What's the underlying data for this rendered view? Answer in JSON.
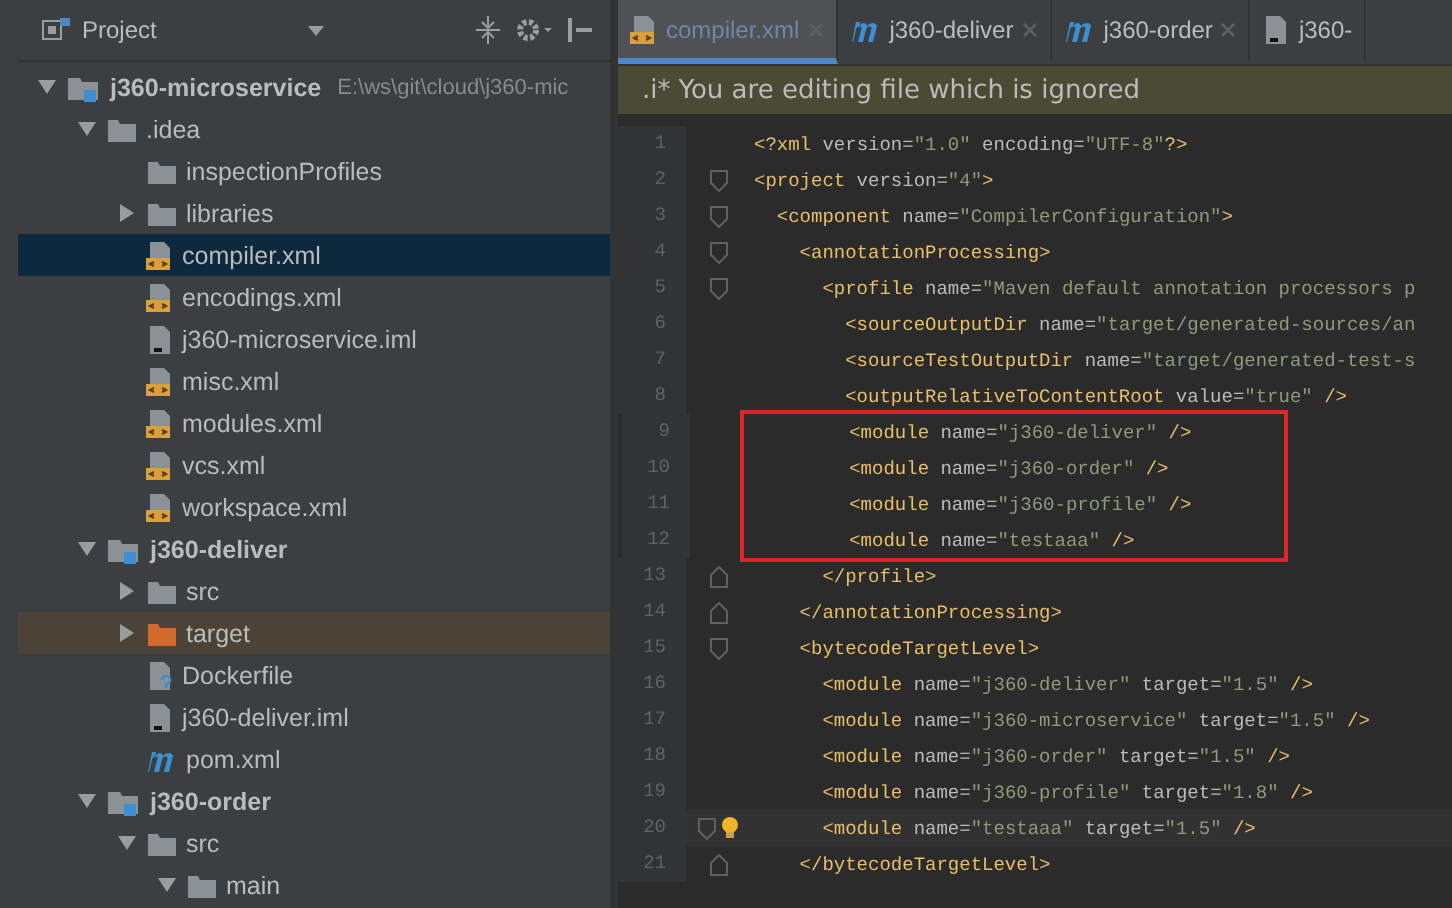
{
  "project_panel": {
    "title": "Project",
    "tree": [
      {
        "label": "j360-microservice",
        "path": "E:\\ws\\git\\cloud\\j360-mic",
        "kind": "module",
        "expanded": true,
        "selected": false,
        "children": [
          {
            "label": ".idea",
            "kind": "folder",
            "expanded": true,
            "selected": false,
            "children": [
              {
                "label": "inspectionProfiles",
                "kind": "folder",
                "selected": false
              },
              {
                "label": "libraries",
                "kind": "folder",
                "expanded": false,
                "selected": false
              },
              {
                "label": "compiler.xml",
                "kind": "xml",
                "selected": true
              },
              {
                "label": "encodings.xml",
                "kind": "xml",
                "selected": false
              },
              {
                "label": "j360-microservice.iml",
                "kind": "iml",
                "selected": false
              },
              {
                "label": "misc.xml",
                "kind": "xml",
                "selected": false
              },
              {
                "label": "modules.xml",
                "kind": "xml",
                "selected": false
              },
              {
                "label": "vcs.xml",
                "kind": "xml",
                "selected": false
              },
              {
                "label": "workspace.xml",
                "kind": "xml",
                "selected": false
              }
            ]
          },
          {
            "label": "j360-deliver",
            "kind": "module",
            "expanded": true,
            "selected": false,
            "children": [
              {
                "label": "src",
                "kind": "folder",
                "expanded": false,
                "selected": false
              },
              {
                "label": "target",
                "kind": "excluded",
                "expanded": false,
                "selected": false,
                "hovered": true
              },
              {
                "label": "Dockerfile",
                "kind": "dockerfile",
                "selected": false
              },
              {
                "label": "j360-deliver.iml",
                "kind": "iml",
                "selected": false
              },
              {
                "label": "pom.xml",
                "kind": "maven",
                "selected": false
              }
            ]
          },
          {
            "label": "j360-order",
            "kind": "module",
            "expanded": true,
            "selected": false,
            "children": [
              {
                "label": "src",
                "kind": "folder",
                "expanded": true,
                "selected": false,
                "children": [
                  {
                    "label": "main",
                    "kind": "folder",
                    "expanded": true,
                    "selected": false
                  }
                ]
              }
            ]
          }
        ]
      }
    ]
  },
  "editor": {
    "tabs": [
      {
        "label": "compiler.xml",
        "kind": "xml",
        "selected": true,
        "closable": true
      },
      {
        "label": "j360-deliver",
        "kind": "maven",
        "selected": false,
        "closable": true
      },
      {
        "label": "j360-order",
        "kind": "maven",
        "selected": false,
        "closable": true
      },
      {
        "label": "j360-",
        "kind": "iml",
        "selected": false,
        "closable": false
      }
    ],
    "banner": {
      "badge": ".i*",
      "message": "You are editing file which is ignored"
    },
    "lines": [
      {
        "number": "1",
        "segments": [
          {
            "kind": "tag",
            "text": "<?xml"
          },
          {
            "kind": "attr",
            "text": " version="
          },
          {
            "kind": "value",
            "text": "\"1.0\""
          },
          {
            "kind": "attr",
            "text": " encoding="
          },
          {
            "kind": "value",
            "text": "\"UTF-8\""
          },
          {
            "kind": "tag",
            "text": "?>"
          }
        ],
        "boxed": false,
        "current": false
      },
      {
        "number": "2",
        "segments": [
          {
            "kind": "tag",
            "text": "<project"
          },
          {
            "kind": "attr",
            "text": " version="
          },
          {
            "kind": "value",
            "text": "\"4\""
          },
          {
            "kind": "tag",
            "text": ">"
          }
        ],
        "boxed": false,
        "current": false,
        "fold_open": true
      },
      {
        "number": "3",
        "segments": [
          {
            "kind": "tag",
            "text": "  <component"
          },
          {
            "kind": "attr",
            "text": " name="
          },
          {
            "kind": "value",
            "text": "\"CompilerConfiguration\""
          },
          {
            "kind": "tag",
            "text": ">"
          }
        ],
        "boxed": false,
        "current": false,
        "fold_open": true
      },
      {
        "number": "4",
        "segments": [
          {
            "kind": "tag",
            "text": "    <annotationProcessing>"
          }
        ],
        "boxed": false,
        "current": false,
        "fold_open": true
      },
      {
        "number": "5",
        "segments": [
          {
            "kind": "tag",
            "text": "      <profile"
          },
          {
            "kind": "attr",
            "text": " name="
          },
          {
            "kind": "value",
            "text": "\"Maven default annotation processors p"
          }
        ],
        "boxed": false,
        "current": false,
        "fold_open": true
      },
      {
        "number": "6",
        "segments": [
          {
            "kind": "tag",
            "text": "        <sourceOutputDir"
          },
          {
            "kind": "attr",
            "text": " name="
          },
          {
            "kind": "value",
            "text": "\"target/generated-sources/an"
          }
        ],
        "boxed": false,
        "current": false
      },
      {
        "number": "7",
        "segments": [
          {
            "kind": "tag",
            "text": "        <sourceTestOutputDir"
          },
          {
            "kind": "attr",
            "text": " name="
          },
          {
            "kind": "value",
            "text": "\"target/generated-test-s"
          }
        ],
        "boxed": false,
        "current": false
      },
      {
        "number": "8",
        "segments": [
          {
            "kind": "tag",
            "text": "        <outputRelativeToContentRoot"
          },
          {
            "kind": "attr",
            "text": " value="
          },
          {
            "kind": "value",
            "text": "\"true\""
          },
          {
            "kind": "tag",
            "text": " />"
          }
        ],
        "boxed": false,
        "current": false
      },
      {
        "number": "9",
        "segments": [
          {
            "kind": "tag",
            "text": "        <module"
          },
          {
            "kind": "attr",
            "text": " name="
          },
          {
            "kind": "value",
            "text": "\"j360-deliver\""
          },
          {
            "kind": "tag",
            "text": " />"
          }
        ],
        "boxed": true,
        "current": false
      },
      {
        "number": "10",
        "segments": [
          {
            "kind": "tag",
            "text": "        <module"
          },
          {
            "kind": "attr",
            "text": " name="
          },
          {
            "kind": "value",
            "text": "\"j360-order\""
          },
          {
            "kind": "tag",
            "text": " />"
          }
        ],
        "boxed": true,
        "current": false
      },
      {
        "number": "11",
        "segments": [
          {
            "kind": "tag",
            "text": "        <module"
          },
          {
            "kind": "attr",
            "text": " name="
          },
          {
            "kind": "value",
            "text": "\"j360-profile\""
          },
          {
            "kind": "tag",
            "text": " />"
          }
        ],
        "boxed": true,
        "current": false
      },
      {
        "number": "12",
        "segments": [
          {
            "kind": "tag",
            "text": "        <module"
          },
          {
            "kind": "attr",
            "text": " name="
          },
          {
            "kind": "value",
            "text": "\"testaaa\""
          },
          {
            "kind": "tag",
            "text": " />"
          }
        ],
        "boxed": true,
        "current": false
      },
      {
        "number": "13",
        "segments": [
          {
            "kind": "tag",
            "text": "      </profile>"
          }
        ],
        "boxed": false,
        "current": false,
        "fold_close": true
      },
      {
        "number": "14",
        "segments": [
          {
            "kind": "tag",
            "text": "    </annotationProcessing>"
          }
        ],
        "boxed": false,
        "current": false,
        "fold_close": true
      },
      {
        "number": "15",
        "segments": [
          {
            "kind": "tag",
            "text": "    <bytecodeTargetLevel>"
          }
        ],
        "boxed": false,
        "current": false,
        "fold_open": true
      },
      {
        "number": "16",
        "segments": [
          {
            "kind": "tag",
            "text": "      <module"
          },
          {
            "kind": "attr",
            "text": " name="
          },
          {
            "kind": "value",
            "text": "\"j360-deliver\""
          },
          {
            "kind": "attr",
            "text": " target="
          },
          {
            "kind": "value",
            "text": "\"1.5\""
          },
          {
            "kind": "tag",
            "text": " />"
          }
        ],
        "boxed": false,
        "current": false
      },
      {
        "number": "17",
        "segments": [
          {
            "kind": "tag",
            "text": "      <module"
          },
          {
            "kind": "attr",
            "text": " name="
          },
          {
            "kind": "value",
            "text": "\"j360-microservice\""
          },
          {
            "kind": "attr",
            "text": " target="
          },
          {
            "kind": "value",
            "text": "\"1.5\""
          },
          {
            "kind": "tag",
            "text": " />"
          }
        ],
        "boxed": false,
        "current": false
      },
      {
        "number": "18",
        "segments": [
          {
            "kind": "tag",
            "text": "      <module"
          },
          {
            "kind": "attr",
            "text": " name="
          },
          {
            "kind": "value",
            "text": "\"j360-order\""
          },
          {
            "kind": "attr",
            "text": " target="
          },
          {
            "kind": "value",
            "text": "\"1.5\""
          },
          {
            "kind": "tag",
            "text": " />"
          }
        ],
        "boxed": false,
        "current": false
      },
      {
        "number": "19",
        "segments": [
          {
            "kind": "tag",
            "text": "      <module"
          },
          {
            "kind": "attr",
            "text": " name="
          },
          {
            "kind": "value",
            "text": "\"j360-profile\""
          },
          {
            "kind": "attr",
            "text": " target="
          },
          {
            "kind": "value",
            "text": "\"1.8\""
          },
          {
            "kind": "tag",
            "text": " />"
          }
        ],
        "boxed": false,
        "current": false
      },
      {
        "number": "20",
        "segments": [
          {
            "kind": "tag",
            "text": "      <module"
          },
          {
            "kind": "attr",
            "text": " name="
          },
          {
            "kind": "value",
            "text": "\"testaaa\""
          },
          {
            "kind": "attr",
            "text": " target="
          },
          {
            "kind": "value",
            "text": "\"1.5\""
          },
          {
            "kind": "tag",
            "text": " />"
          }
        ],
        "boxed": false,
        "current": true,
        "fold_open": true
      },
      {
        "number": "21",
        "segments": [
          {
            "kind": "tag",
            "text": "    </bytecodeTargetLevel>"
          }
        ],
        "boxed": false,
        "current": false,
        "fold_close": true
      }
    ]
  }
}
